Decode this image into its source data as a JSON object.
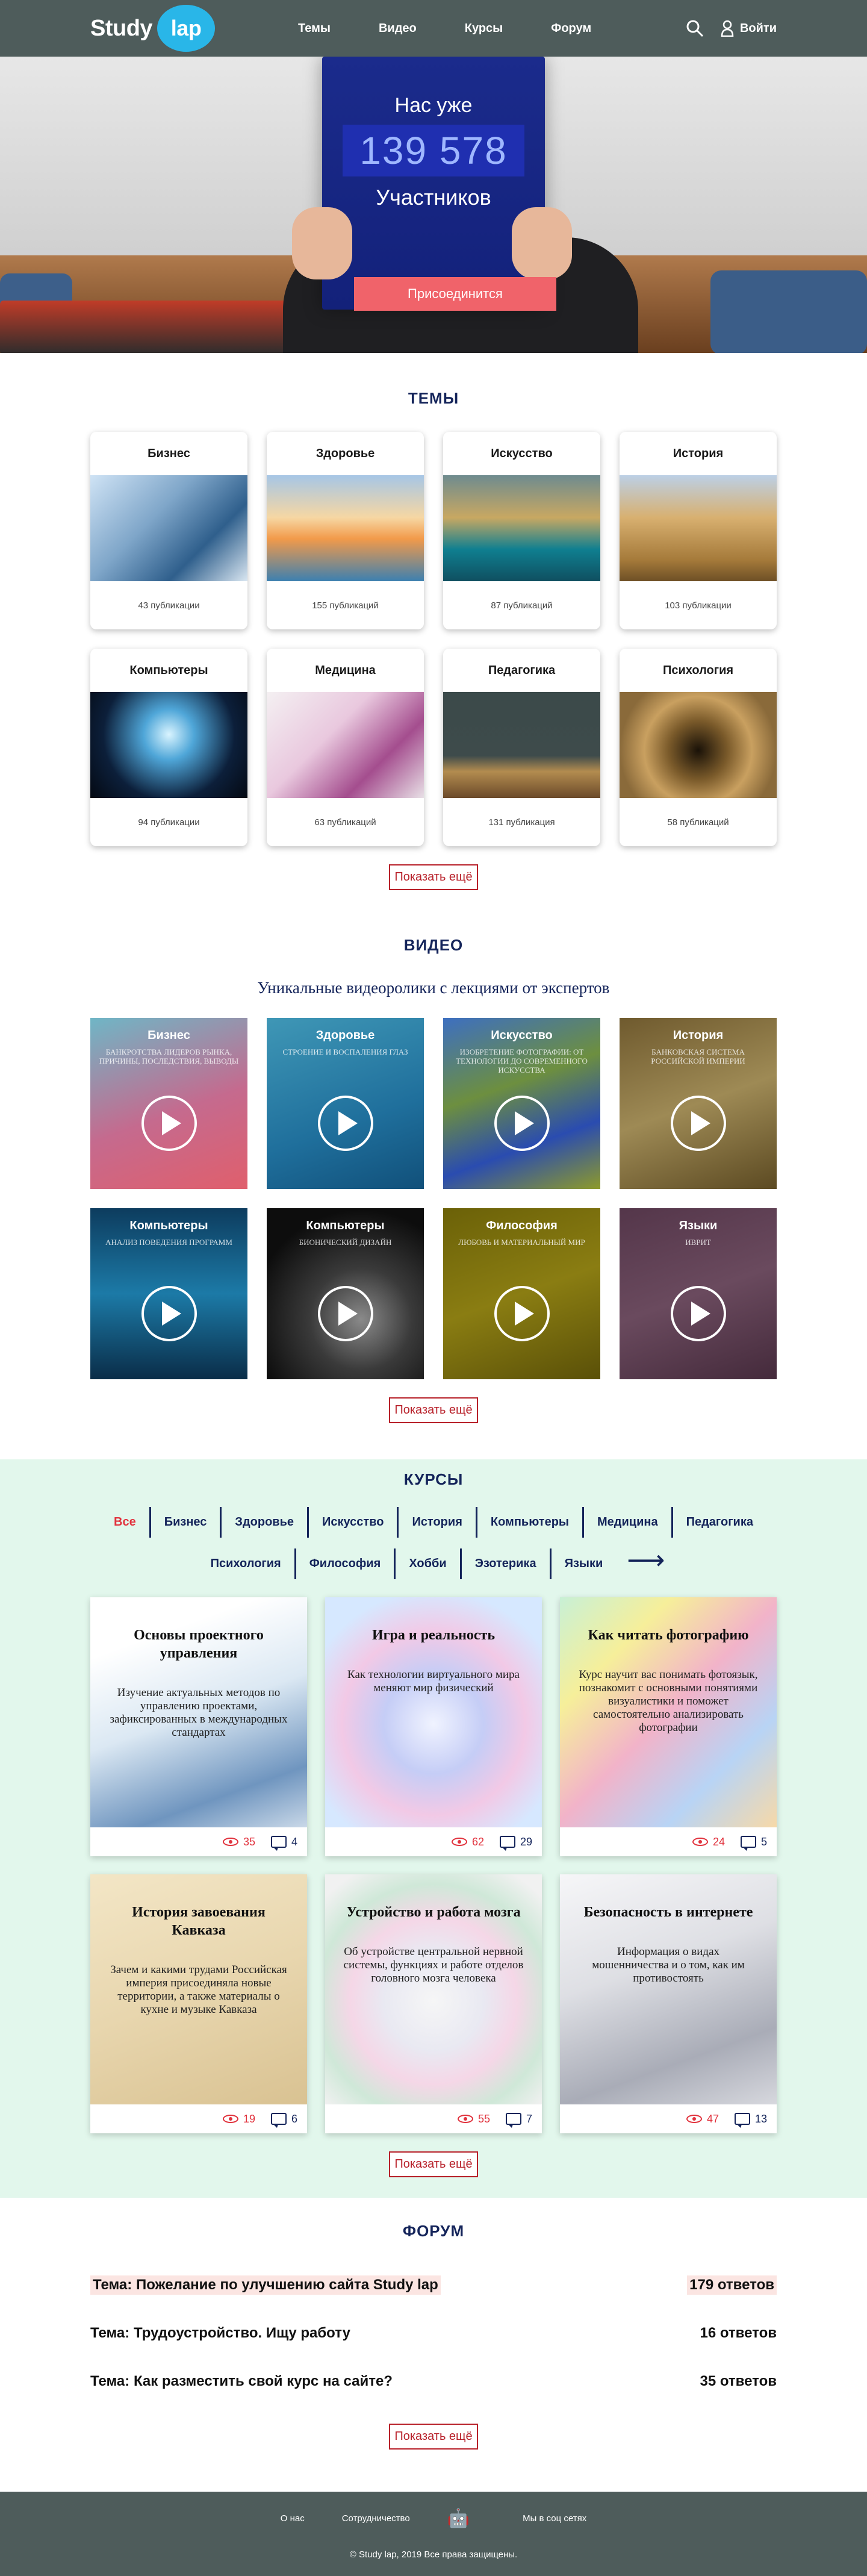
{
  "header": {
    "logo_study": "Study",
    "logo_lap": "lap",
    "nav": [
      "Темы",
      "Видео",
      "Курсы",
      "Форум"
    ],
    "login_label": "Войти",
    "search_icon": "search-icon",
    "user_icon": "user-icon",
    "background": "#4e5c5b"
  },
  "hero": {
    "subtitle": "Нас уже",
    "count": "139 578",
    "members_label": "Участников",
    "join_label": "Присоединится",
    "accent": "#f0636a"
  },
  "topics": {
    "title": "ТЕМЫ",
    "items": [
      {
        "name": "Бизнес",
        "count": "43 публикации"
      },
      {
        "name": "Здоровье",
        "count": "155 публикаций"
      },
      {
        "name": "Искусство",
        "count": "87 публикаций"
      },
      {
        "name": "История",
        "count": "103 публикации"
      },
      {
        "name": "Компьютеры",
        "count": "94 публикации"
      },
      {
        "name": "Медицина",
        "count": "63 публикаций"
      },
      {
        "name": "Педагогика",
        "count": "131 публикация"
      },
      {
        "name": "Психология",
        "count": "58 публикаций"
      }
    ],
    "more_label": "Показать ещё"
  },
  "videos": {
    "title": "ВИДЕО",
    "subtitle": "Уникальные видеоролики с лекциями от экспертов",
    "items": [
      {
        "title": "Бизнес",
        "desc": "Банкротства лидеров рынка, причины, последствия, выводы"
      },
      {
        "title": "Здоровье",
        "desc": "Строение и воспаления глаз"
      },
      {
        "title": "Искусство",
        "desc": "Изобретение фотографии: от технологии до современного искусства"
      },
      {
        "title": "История",
        "desc": "Банковская система Российской империи"
      },
      {
        "title": "Компьютеры",
        "desc": "Анализ поведения программ"
      },
      {
        "title": "Компьютеры",
        "desc": "Бионический дизайн"
      },
      {
        "title": "Философия",
        "desc": "Любовь и материальный мир"
      },
      {
        "title": "Языки",
        "desc": "Иврит"
      }
    ],
    "more_label": "Показать ещё"
  },
  "courses": {
    "title": "КУРСЫ",
    "filters_row1": [
      "Все",
      "Бизнес",
      "Здоровье",
      "Искусство",
      "История",
      "Компьютеры",
      "Медицина",
      "Педагогика"
    ],
    "filters_row2": [
      "Психология",
      "Философия",
      "Хобби",
      "Эзотерика",
      "Языки"
    ],
    "items": [
      {
        "title": "Основы проектного управления",
        "desc": "Изучение актуальных методов по управлению проектами, зафиксированных в международных стандартах",
        "views": "35",
        "comments": "4"
      },
      {
        "title": "Игра и реальность",
        "desc": "Как технологии виртуального мира меняют мир физический",
        "views": "62",
        "comments": "29"
      },
      {
        "title": "Как читать фотографию",
        "desc": "Курс научит вас понимать фотоязык, познакомит с основными понятиями визуалистики и поможет самостоятельно анализировать фотографии",
        "views": "24",
        "comments": "5"
      },
      {
        "title": "История завоевания Кавказа",
        "desc": "Зачем и какими трудами Российская империя присоединяла новые территории, а также материалы о кухне и музыке Кавказа",
        "views": "19",
        "comments": "6"
      },
      {
        "title": "Устройство и работа мозга",
        "desc": "Об устройстве центральной нервной системы, функциях и работе отделов головного мозга человека",
        "views": "55",
        "comments": "7"
      },
      {
        "title": "Безопасность в интернете",
        "desc": "Информация о видах мошенничества и о том, как им противостоять",
        "views": "47",
        "comments": "13"
      }
    ],
    "more_label": "Показать ещё"
  },
  "forum": {
    "title": "ФОРУМ",
    "items": [
      {
        "topic": "Тема: Пожелание по улучшению сайта Study lap",
        "answers": "179 ответов"
      },
      {
        "topic": "Тема: Трудоустройство. Ищу работу",
        "answers": "16 ответов"
      },
      {
        "topic": "Тема: Как разместить свой курс на сайте?",
        "answers": "35 ответов"
      }
    ],
    "more_label": "Показать ещё"
  },
  "footer": {
    "about": "О нас",
    "cooperation": "Сотрудничество",
    "social": "Мы в соц сетях",
    "copyright": "© Study lap, 2019 Все права защищены."
  }
}
